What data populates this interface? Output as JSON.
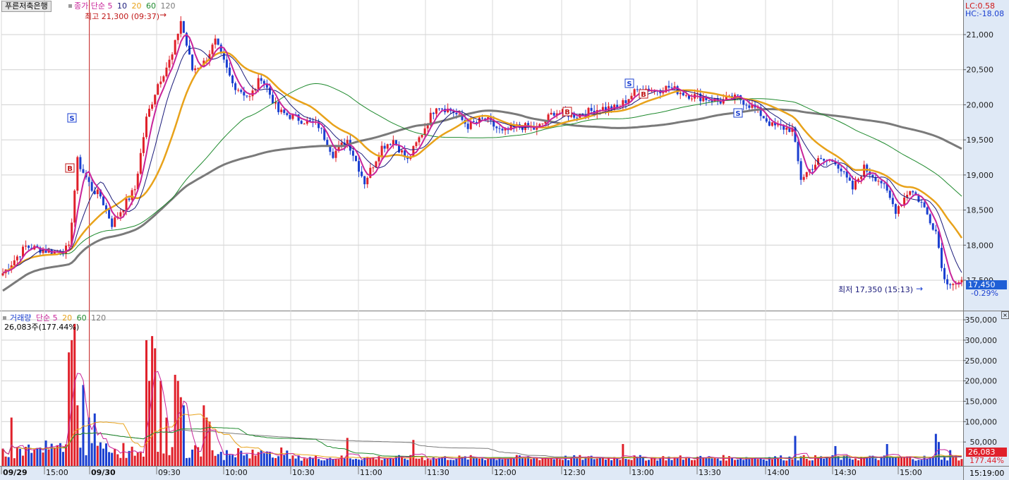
{
  "price_panel": {
    "stock_name": "푸른저축은행",
    "ma_label": "종가 단순",
    "ma_periods": [
      "5",
      "10",
      "20",
      "60",
      "120"
    ],
    "high_marker": "최고 21,300 (09:37)",
    "low_marker": "최저 17,350 (15:13)",
    "lc_label": "LC:0.58",
    "hc_label": "HC:-18.08",
    "current_price": "17,450",
    "change_pct": "-0.29%",
    "y_ticks": [
      "21,000",
      "20,500",
      "20,000",
      "19,500",
      "19,000",
      "18,500",
      "18,000",
      "17,500"
    ]
  },
  "volume_panel": {
    "title": "거래량",
    "ma_label": "단순",
    "ma_periods": [
      "5",
      "20",
      "60",
      "120"
    ],
    "readout": "26,083주(177.44%)",
    "current_volume": "26,083",
    "current_pct": "177.44%",
    "y_ticks": [
      "350,000",
      "300,000",
      "250,000",
      "200,000",
      "150,000",
      "100,000",
      "50,000"
    ]
  },
  "x_axis": {
    "labels": [
      "09/29",
      "15:00",
      "09/30",
      "09:30",
      "10:00",
      "10:30",
      "11:00",
      "11:30",
      "12:00",
      "12:30",
      "13:00",
      "13:30",
      "14:00",
      "14:30",
      "15:00"
    ],
    "cursor_time": "15:19:00"
  },
  "signals": [
    {
      "label": "S",
      "x": 102,
      "y": 167
    },
    {
      "label": "B",
      "x": 99,
      "y": 238
    },
    {
      "label": "S",
      "x": 892,
      "y": 118
    },
    {
      "label": "B",
      "x": 804,
      "y": 158
    },
    {
      "label": "B",
      "x": 912,
      "y": 133
    },
    {
      "label": "S",
      "x": 1046,
      "y": 160
    }
  ],
  "colors": {
    "up": "#e0202a",
    "down": "#1a3fd0",
    "ma5": "#c8249a",
    "ma10": "#1a1a7a",
    "ma20": "#e8a21a",
    "ma60": "#1f8a2e",
    "ma120": "#7a7a7a",
    "price_badge": "#1f5fd6",
    "volume_badge": "#e0202a"
  },
  "chart_data": {
    "type": "candlestick",
    "y_range": [
      17300,
      21350
    ],
    "volume_range": [
      0,
      360000
    ],
    "anchors": [
      {
        "t": 0,
        "p": 17600
      },
      {
        "t": 8,
        "p": 17980
      },
      {
        "t": 18,
        "p": 17900
      },
      {
        "t": 23,
        "p": 17950
      },
      {
        "t": 26,
        "p": 19200
      },
      {
        "t": 31,
        "p": 18800
      },
      {
        "t": 34,
        "p": 18700
      },
      {
        "t": 38,
        "p": 18300
      },
      {
        "t": 46,
        "p": 18800
      },
      {
        "t": 50,
        "p": 19800
      },
      {
        "t": 54,
        "p": 20300
      },
      {
        "t": 59,
        "p": 20700
      },
      {
        "t": 62,
        "p": 21200
      },
      {
        "t": 66,
        "p": 20500
      },
      {
        "t": 70,
        "p": 20600
      },
      {
        "t": 74,
        "p": 20900
      },
      {
        "t": 80,
        "p": 20300
      },
      {
        "t": 86,
        "p": 20100
      },
      {
        "t": 90,
        "p": 20400
      },
      {
        "t": 96,
        "p": 19900
      },
      {
        "t": 103,
        "p": 19800
      },
      {
        "t": 110,
        "p": 19700
      },
      {
        "t": 115,
        "p": 19300
      },
      {
        "t": 120,
        "p": 19500
      },
      {
        "t": 126,
        "p": 18900
      },
      {
        "t": 132,
        "p": 19400
      },
      {
        "t": 136,
        "p": 19500
      },
      {
        "t": 141,
        "p": 19200
      },
      {
        "t": 146,
        "p": 19600
      },
      {
        "t": 151,
        "p": 20000
      },
      {
        "t": 157,
        "p": 19900
      },
      {
        "t": 162,
        "p": 19700
      },
      {
        "t": 168,
        "p": 19800
      },
      {
        "t": 174,
        "p": 19600
      },
      {
        "t": 180,
        "p": 19700
      },
      {
        "t": 186,
        "p": 19650
      },
      {
        "t": 192,
        "p": 19900
      },
      {
        "t": 200,
        "p": 19850
      },
      {
        "t": 208,
        "p": 19950
      },
      {
        "t": 214,
        "p": 19950
      },
      {
        "t": 218,
        "p": 20100
      },
      {
        "t": 222,
        "p": 20250
      },
      {
        "t": 227,
        "p": 20200
      },
      {
        "t": 232,
        "p": 20250
      },
      {
        "t": 238,
        "p": 20150
      },
      {
        "t": 244,
        "p": 20100
      },
      {
        "t": 250,
        "p": 20050
      },
      {
        "t": 256,
        "p": 20100
      },
      {
        "t": 262,
        "p": 19950
      },
      {
        "t": 268,
        "p": 19700
      },
      {
        "t": 275,
        "p": 19650
      },
      {
        "t": 278,
        "p": 18950
      },
      {
        "t": 284,
        "p": 19200
      },
      {
        "t": 290,
        "p": 19200
      },
      {
        "t": 296,
        "p": 18800
      },
      {
        "t": 300,
        "p": 19100
      },
      {
        "t": 306,
        "p": 18900
      },
      {
        "t": 311,
        "p": 18500
      },
      {
        "t": 316,
        "p": 18800
      },
      {
        "t": 320,
        "p": 18600
      },
      {
        "t": 325,
        "p": 18200
      },
      {
        "t": 328,
        "p": 17500
      },
      {
        "t": 333,
        "p": 17450
      }
    ],
    "volume_spikes": [
      {
        "t": 3,
        "v": 110000
      },
      {
        "t": 23,
        "v": 270000
      },
      {
        "t": 24,
        "v": 300000
      },
      {
        "t": 25,
        "v": 340000
      },
      {
        "t": 26,
        "v": 140000
      },
      {
        "t": 28,
        "v": 190000
      },
      {
        "t": 30,
        "v": 110000
      },
      {
        "t": 32,
        "v": 120000
      },
      {
        "t": 50,
        "v": 300000
      },
      {
        "t": 51,
        "v": 200000
      },
      {
        "t": 52,
        "v": 310000
      },
      {
        "t": 53,
        "v": 280000
      },
      {
        "t": 55,
        "v": 200000
      },
      {
        "t": 57,
        "v": 110000
      },
      {
        "t": 60,
        "v": 215000
      },
      {
        "t": 61,
        "v": 200000
      },
      {
        "t": 62,
        "v": 160000
      },
      {
        "t": 63,
        "v": 140000
      },
      {
        "t": 70,
        "v": 140000
      },
      {
        "t": 71,
        "v": 110000
      },
      {
        "t": 72,
        "v": 100000
      },
      {
        "t": 120,
        "v": 60000
      },
      {
        "t": 143,
        "v": 55000
      },
      {
        "t": 216,
        "v": 45000
      },
      {
        "t": 276,
        "v": 65000
      },
      {
        "t": 290,
        "v": 40000
      },
      {
        "t": 308,
        "v": 45000
      },
      {
        "t": 325,
        "v": 70000
      },
      {
        "t": 326,
        "v": 50000
      },
      {
        "t": 330,
        "v": 30000
      }
    ]
  }
}
